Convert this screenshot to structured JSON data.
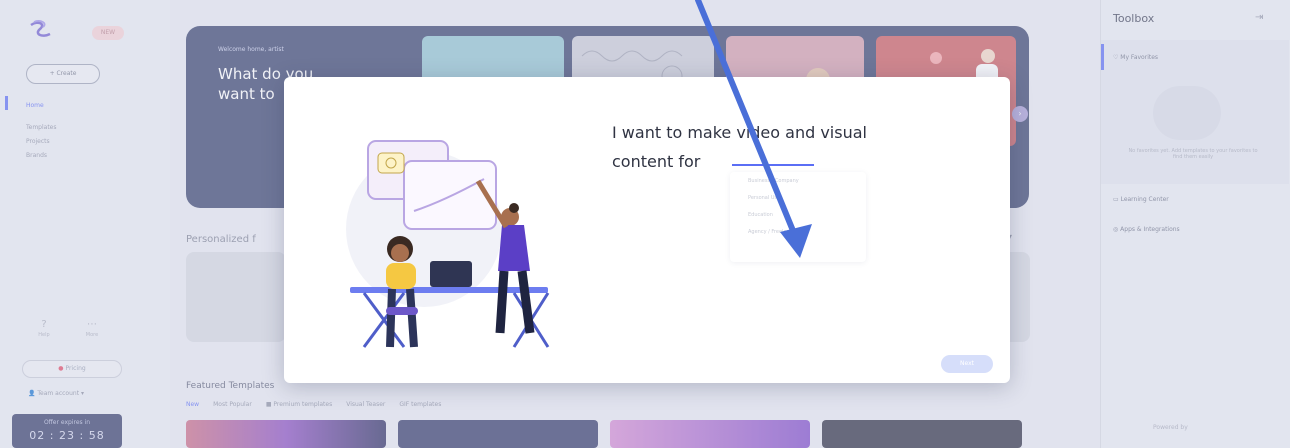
{
  "sidebar": {
    "badge": "NEW",
    "create_label": "+ Create",
    "nav": [
      "Home",
      "Templates",
      "Projects",
      "Brands"
    ],
    "help": [
      {
        "label": "Help"
      },
      {
        "label": "More"
      }
    ],
    "pricing_label": "Pricing",
    "account_label": "Team account",
    "timer": {
      "label": "Offer expires in",
      "value": "02 : 23 : 58"
    }
  },
  "hero": {
    "welcome": "Welcome home, artist",
    "title_line1": "What do you",
    "title_line2": "want to"
  },
  "main": {
    "personalized_title": "Personalized f",
    "featured_title": "Featured Templates",
    "template_tabs": [
      "New",
      "Most Popular",
      "Premium templates",
      "Visual Teaser",
      "GIF templates"
    ]
  },
  "toolbox": {
    "title": "Toolbox",
    "items": [
      "My Favorites",
      "Learning Center",
      "Apps & Integrations"
    ],
    "favorites_desc": "No favorites yet. Add templates to your favorites to find them easily",
    "footer": "Powered by"
  },
  "modal": {
    "question_line1": "I want to make video and visual",
    "question_line2": "content for",
    "options": [
      "Business / Company",
      "Personal Use",
      "Education",
      "Agency / Freelance"
    ],
    "next_label": "Next"
  },
  "colors": {
    "accent": "#5b6ef5",
    "hero_bg": "#36416e",
    "arrow": "#4a6fd8",
    "timer_bg": "#353c6b"
  }
}
